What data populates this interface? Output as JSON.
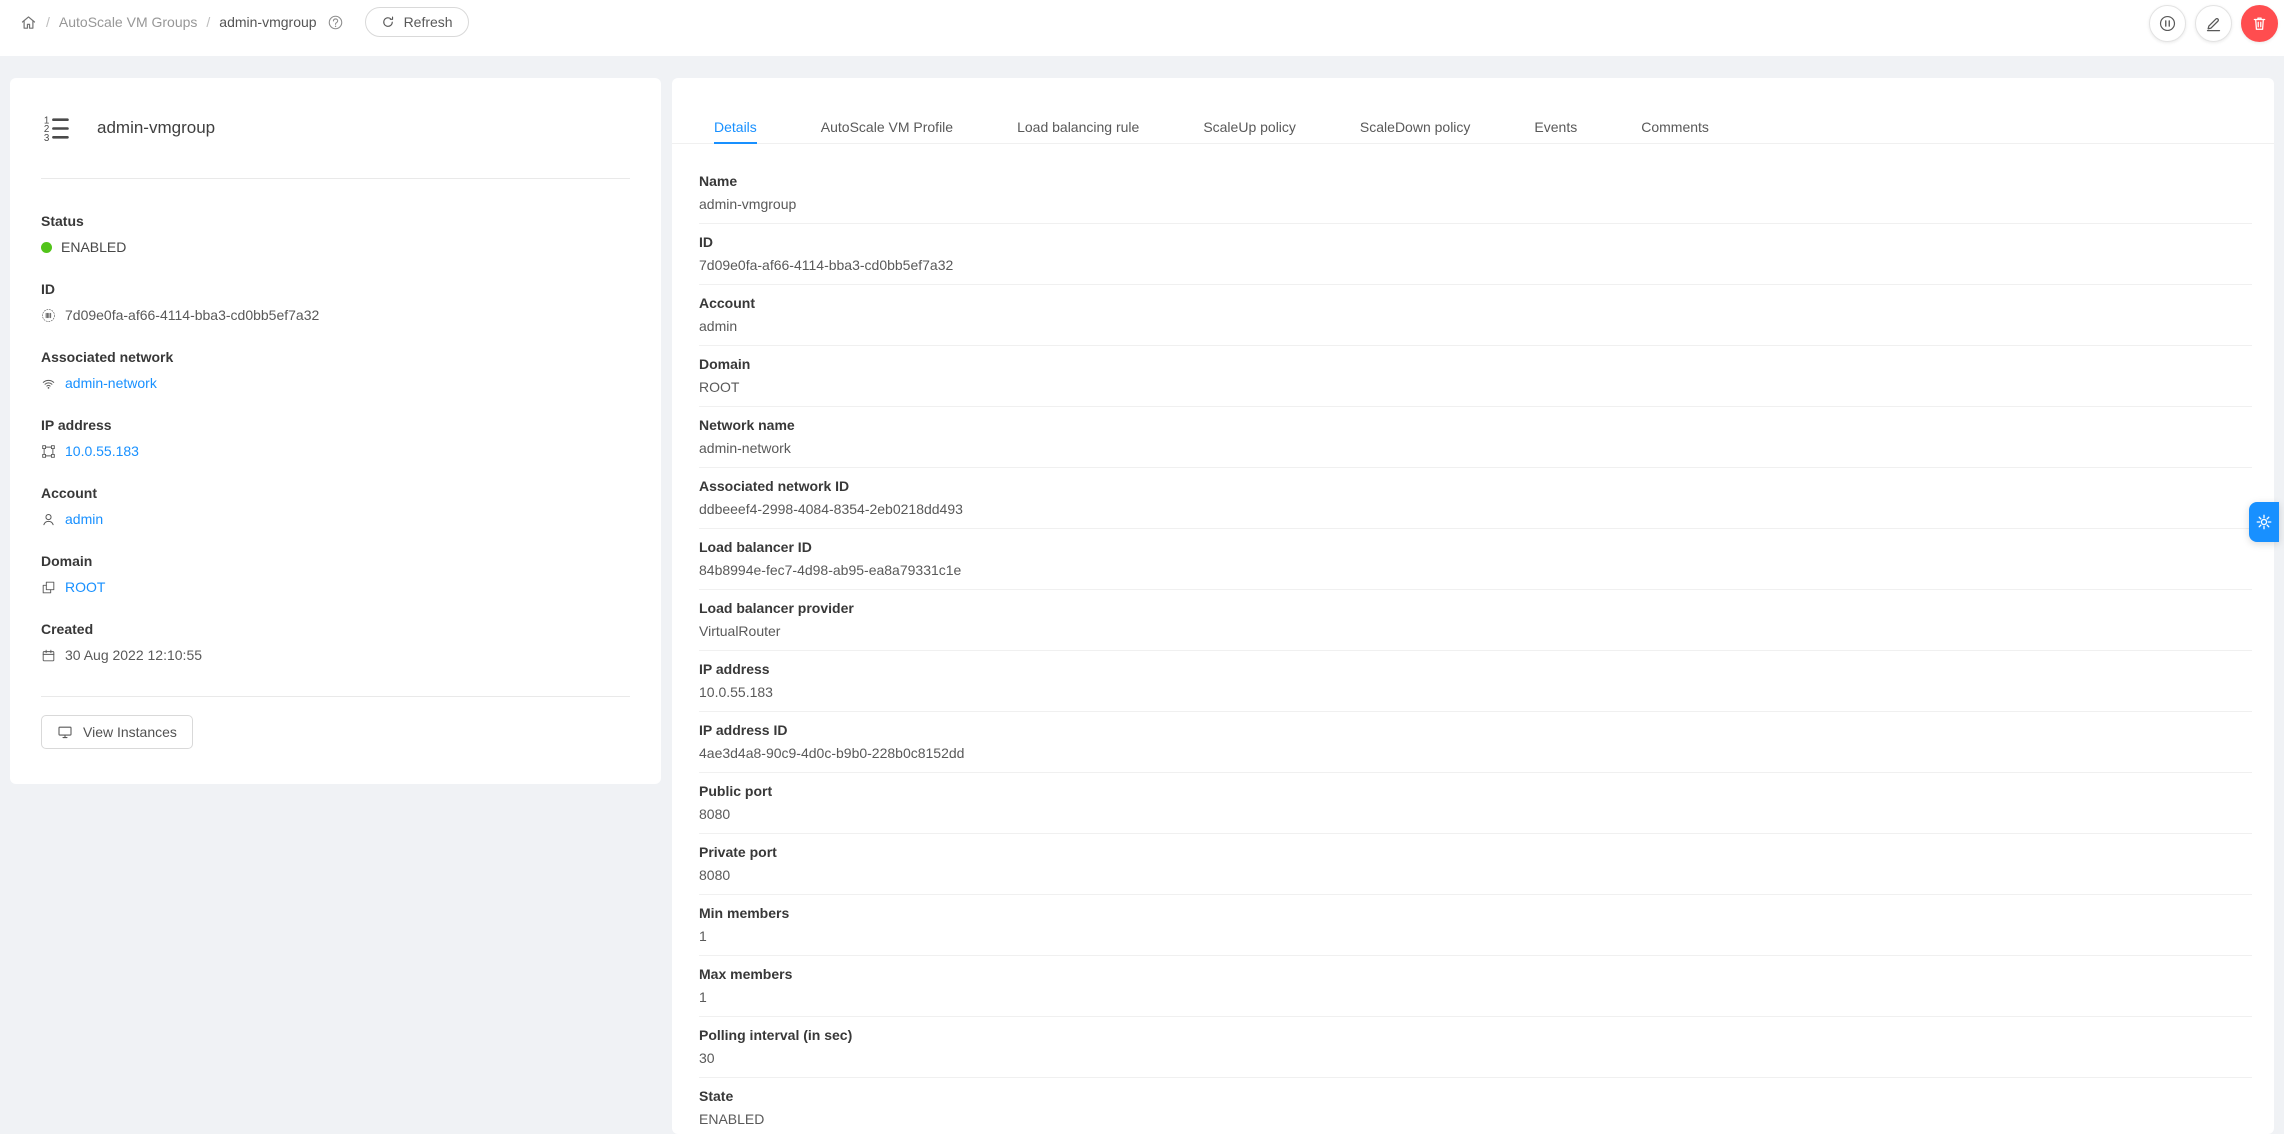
{
  "breadcrumb": {
    "section": "AutoScale VM Groups",
    "current": "admin-vmgroup",
    "separator": "/",
    "refresh_label": "Refresh",
    "icons": {
      "home": "home",
      "help": "question-circle",
      "reload": "reload"
    }
  },
  "header_actions": [
    {
      "name": "pause-vmgroup",
      "icon": "pause-circle",
      "style": "default"
    },
    {
      "name": "edit-vmgroup",
      "icon": "edit",
      "style": "default"
    },
    {
      "name": "delete-vmgroup",
      "icon": "delete",
      "style": "danger"
    }
  ],
  "resource_card": {
    "icon": "ordered-list",
    "title": "admin-vmgroup",
    "fields": [
      {
        "label": "Status",
        "value": "ENABLED",
        "icon": "",
        "type": "status"
      },
      {
        "label": "ID",
        "value": "7d09e0fa-af66-4114-bba3-cd0bb5ef7a32",
        "icon": "barcode",
        "type": "text"
      },
      {
        "label": "Associated network",
        "value": "admin-network",
        "icon": "wifi",
        "type": "link"
      },
      {
        "label": "IP address",
        "value": "10.0.55.183",
        "icon": "gateway",
        "type": "link"
      },
      {
        "label": "Account",
        "value": "admin",
        "icon": "user",
        "type": "link"
      },
      {
        "label": "Domain",
        "value": "ROOT",
        "icon": "block",
        "type": "link"
      },
      {
        "label": "Created",
        "value": "30 Aug 2022 12:10:55",
        "icon": "calendar",
        "type": "text"
      }
    ],
    "view_instances": {
      "label": "View Instances",
      "icon": "desktop"
    }
  },
  "tabs": [
    {
      "label": "Details",
      "active": true
    },
    {
      "label": "AutoScale VM Profile",
      "active": false
    },
    {
      "label": "Load balancing rule",
      "active": false
    },
    {
      "label": "ScaleUp policy",
      "active": false
    },
    {
      "label": "ScaleDown policy",
      "active": false
    },
    {
      "label": "Events",
      "active": false
    },
    {
      "label": "Comments",
      "active": false
    }
  ],
  "details": {
    "rows": [
      {
        "label": "Name",
        "value": "admin-vmgroup"
      },
      {
        "label": "ID",
        "value": "7d09e0fa-af66-4114-bba3-cd0bb5ef7a32"
      },
      {
        "label": "Account",
        "value": "admin"
      },
      {
        "label": "Domain",
        "value": "ROOT"
      },
      {
        "label": "Network name",
        "value": "admin-network"
      },
      {
        "label": "Associated network ID",
        "value": "ddbeeef4-2998-4084-8354-2eb0218dd493"
      },
      {
        "label": "Load balancer ID",
        "value": "84b8994e-fec7-4d98-ab95-ea8a79331c1e"
      },
      {
        "label": "Load balancer provider",
        "value": "VirtualRouter"
      },
      {
        "label": "IP address",
        "value": "10.0.55.183"
      },
      {
        "label": "IP address ID",
        "value": "4ae3d4a8-90c9-4d0c-b9b0-228b0c8152dd"
      },
      {
        "label": "Public port",
        "value": "8080"
      },
      {
        "label": "Private port",
        "value": "8080"
      },
      {
        "label": "Min members",
        "value": "1"
      },
      {
        "label": "Max members",
        "value": "1"
      },
      {
        "label": "Polling interval (in sec)",
        "value": "30"
      },
      {
        "label": "State",
        "value": "ENABLED"
      }
    ]
  },
  "drawer": {
    "icon": "gear"
  },
  "colors": {
    "accent": "#1890ff",
    "link": "#1890ff",
    "status_enabled": "#52c41a",
    "danger": "#ff4d4f",
    "page_bg": "#f0f2f5",
    "card_bg": "#ffffff"
  }
}
